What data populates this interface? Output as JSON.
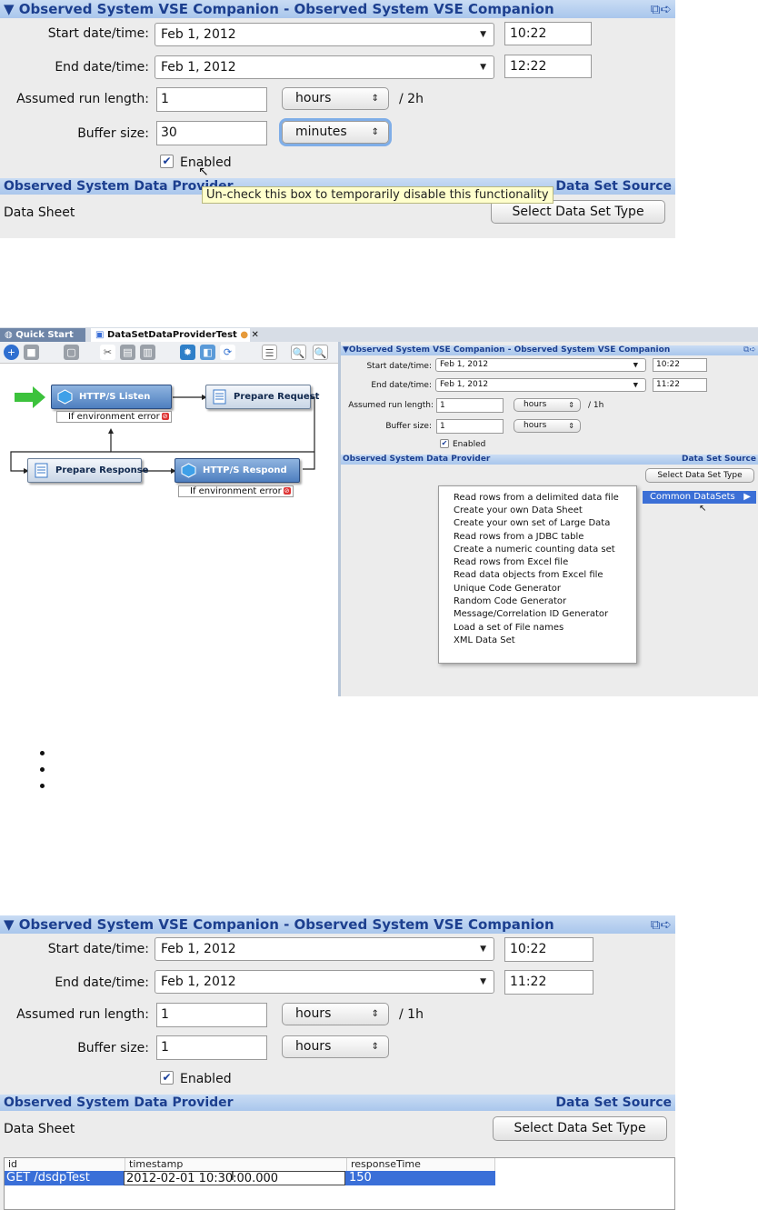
{
  "panel1": {
    "title": "Observed System VSE Companion - Observed System VSE Companion",
    "start_label": "Start date/time:",
    "start_date": "Feb 1, 2012",
    "start_time": "10:22",
    "end_label": "End date/time:",
    "end_date": "Feb 1, 2012",
    "end_time": "12:22",
    "run_label": "Assumed run length:",
    "run_value": "1",
    "run_unit": "hours",
    "run_total": "/ 2h",
    "buffer_label": "Buffer size:",
    "buffer_value": "30",
    "buffer_unit": "minutes",
    "enabled_label": "Enabled",
    "enabled_checked": true,
    "tooltip": "Un-check this box to temporarily disable this functionality",
    "provider_title": "Observed System Data Provider",
    "source_title": "Data Set Source",
    "data_sheet_label": "Data Sheet",
    "select_button": "Select Data Set Type"
  },
  "panel2": {
    "tab_quick_start": "Quick Start",
    "tab_test": "DataSetDataProviderTest",
    "nodes": {
      "listen": "HTTP/S Listen",
      "prepare_request": "Prepare Request",
      "prepare_response": "Prepare Response",
      "respond": "HTTP/S Respond"
    },
    "env_error": "If environment error",
    "right": {
      "title": "Observed System VSE Companion - Observed System VSE Companion",
      "start_label": "Start date/time:",
      "start_date": "Feb 1, 2012",
      "start_time": "10:22",
      "end_label": "End date/time:",
      "end_date": "Feb 1, 2012",
      "end_time": "11:22",
      "run_label": "Assumed run length:",
      "run_value": "1",
      "run_unit": "hours",
      "run_total": "/ 1h",
      "buffer_label": "Buffer size:",
      "buffer_value": "1",
      "buffer_unit": "hours",
      "enabled_label": "Enabled",
      "provider_title": "Observed System Data Provider",
      "source_title": "Data Set Source",
      "select_button": "Select Data Set Type",
      "submenu": "Common DataSets"
    },
    "menu_items": [
      "Read rows from a delimited data file",
      "Create your own Data Sheet",
      "Create your own set of Large Data",
      "Read rows from a JDBC table",
      "Create a numeric counting data set",
      "Read rows from Excel file",
      "Read data objects from Excel file",
      "Unique Code Generator",
      "Random Code Generator",
      "Message/Correlation ID Generator",
      "Load a set of File names",
      "XML Data Set"
    ]
  },
  "panel3": {
    "title": "Observed System VSE Companion - Observed System VSE Companion",
    "start_label": "Start date/time:",
    "start_date": "Feb 1, 2012",
    "start_time": "10:22",
    "end_label": "End date/time:",
    "end_date": "Feb 1, 2012",
    "end_time": "11:22",
    "run_label": "Assumed run length:",
    "run_value": "1",
    "run_unit": "hours",
    "run_total": "/ 1h",
    "buffer_label": "Buffer size:",
    "buffer_value": "1",
    "buffer_unit": "hours",
    "enabled_label": "Enabled",
    "provider_title": "Observed System Data Provider",
    "source_title": "Data Set Source",
    "data_sheet_label": "Data Sheet",
    "select_button": "Select Data Set Type",
    "table": {
      "headers": [
        "id",
        "timestamp",
        "responseTime"
      ],
      "row": [
        "GET /dsdpTest",
        "2012-02-01 10:30:00.000",
        "150"
      ]
    }
  },
  "colors": {
    "header_blue": "#a9c6ec",
    "header_text": "#1c3f8f",
    "selection_blue": "#3a6fd8",
    "tooltip_yellow": "#ffffcc"
  }
}
